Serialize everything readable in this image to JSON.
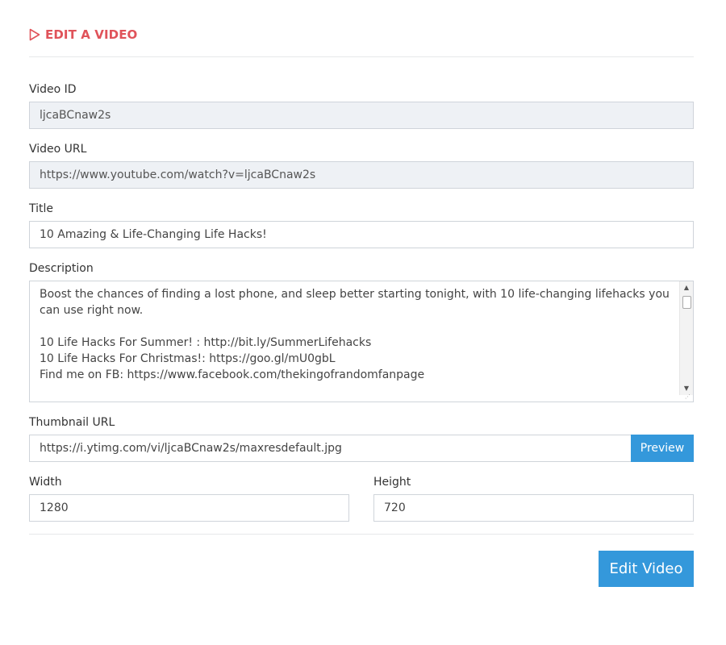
{
  "header": {
    "title": "EDIT A VIDEO",
    "icon": "play-outline-icon",
    "accent_color": "#e0535a"
  },
  "form": {
    "video_id": {
      "label": "Video ID",
      "value": "ljcaBCnaw2s"
    },
    "video_url": {
      "label": "Video URL",
      "value": "https://www.youtube.com/watch?v=ljcaBCnaw2s"
    },
    "title": {
      "label": "Title",
      "value": "10 Amazing & Life-Changing Life Hacks!"
    },
    "description": {
      "label": "Description",
      "value": "Boost the chances of finding a lost phone, and sleep better starting tonight, with 10 life-changing lifehacks you can use right now.\n\n10 Life Hacks For Summer! : http://bit.ly/SummerLifehacks\n10 Life Hacks For Christmas!: https://goo.gl/mU0gbL\nFind me on FB: https://www.facebook.com/thekingofrandomfanpage"
    },
    "thumbnail_url": {
      "label": "Thumbnail URL",
      "value": "https://i.ytimg.com/vi/ljcaBCnaw2s/maxresdefault.jpg",
      "preview_label": "Preview"
    },
    "width": {
      "label": "Width",
      "value": "1280"
    },
    "height": {
      "label": "Height",
      "value": "720"
    },
    "submit_label": "Edit Video"
  },
  "colors": {
    "primary_button": "#3498db",
    "readonly_background": "#eef1f5"
  }
}
